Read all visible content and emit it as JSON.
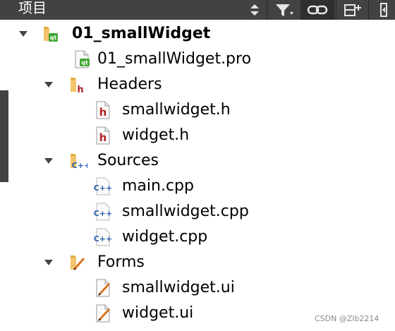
{
  "toolbar": {
    "title": "项目",
    "icons": [
      "sort-arrows-icon",
      "filter-icon",
      "link-icon",
      "split-add-icon",
      "close-panel-icon"
    ]
  },
  "tree": {
    "project": {
      "label": "01_smallWidget",
      "icon": "qt-project-folder-icon"
    },
    "pro_file": {
      "label": "01_smallWidget.pro",
      "icon": "qt-pro-file-icon"
    },
    "headers": {
      "label": "Headers",
      "icon": "headers-folder-icon",
      "files": [
        {
          "label": "smallwidget.h",
          "icon": "header-file-icon"
        },
        {
          "label": "widget.h",
          "icon": "header-file-icon"
        }
      ]
    },
    "sources": {
      "label": "Sources",
      "icon": "sources-folder-icon",
      "files": [
        {
          "label": "main.cpp",
          "icon": "cpp-file-icon"
        },
        {
          "label": "smallwidget.cpp",
          "icon": "cpp-file-icon"
        },
        {
          "label": "widget.cpp",
          "icon": "cpp-file-icon"
        }
      ]
    },
    "forms": {
      "label": "Forms",
      "icon": "forms-folder-icon",
      "files": [
        {
          "label": "smallwidget.ui",
          "icon": "ui-form-file-icon"
        },
        {
          "label": "widget.ui",
          "icon": "ui-form-file-icon"
        }
      ]
    }
  },
  "watermark": "CSDN @Zlb2214",
  "colors": {
    "toolbar_bg": "#404244",
    "folder": "#f2c46a",
    "header_red": "#b22222",
    "cpp_blue": "#2b5fa8",
    "form_orange": "#e0741c",
    "qt_green": "#41a534"
  }
}
